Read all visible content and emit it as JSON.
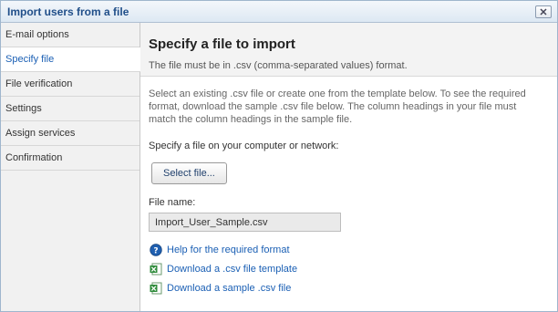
{
  "window": {
    "title": "Import users from a file",
    "close_icon": "close-icon"
  },
  "sidebar": {
    "items": [
      {
        "label": "E-mail options"
      },
      {
        "label": "Specify file"
      },
      {
        "label": "File verification"
      },
      {
        "label": "Settings"
      },
      {
        "label": "Assign services"
      },
      {
        "label": "Confirmation"
      }
    ],
    "active_index": 1
  },
  "main": {
    "heading": "Specify a file to import",
    "subheading": "The file must be in .csv (comma-separated values) format.",
    "intro": "Select an existing .csv file or create one from the template below. To see the required format, download the sample .csv file below. The column headings in your file must match the column headings in the sample file.",
    "specify_label": "Specify a file on your computer or network:",
    "select_button": "Select file...",
    "file_name_label": "File name:",
    "file_name_value": "Import_User_Sample.csv",
    "links": [
      {
        "label": "Help for the required format",
        "icon": "help-icon"
      },
      {
        "label": "Download a .csv file template",
        "icon": "excel-icon"
      },
      {
        "label": "Download a sample .csv file",
        "icon": "excel-icon"
      }
    ]
  },
  "colors": {
    "link": "#1a5fb4",
    "title": "#1f4e89",
    "help_icon": "#1f5fb0",
    "excel_icon": "#2e8b3a"
  }
}
